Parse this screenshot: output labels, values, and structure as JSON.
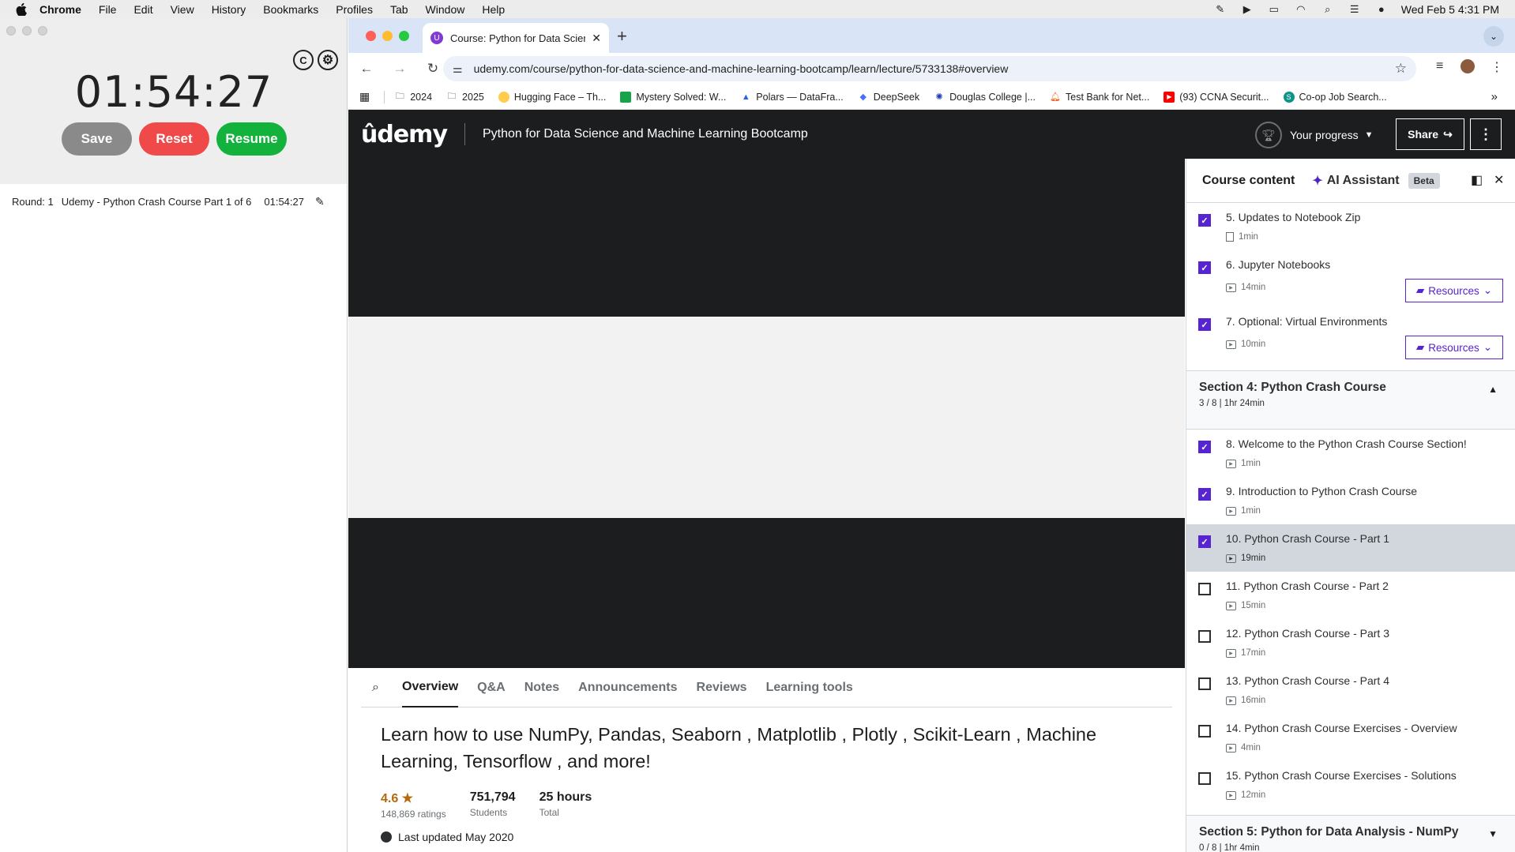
{
  "menubar": {
    "app": "Chrome",
    "items": [
      "File",
      "Edit",
      "View",
      "History",
      "Bookmarks",
      "Profiles",
      "Tab",
      "Window",
      "Help"
    ],
    "datetime": "Wed Feb 5  4:31 PM"
  },
  "timer": {
    "time": "01:54:27",
    "save": "Save",
    "reset": "Reset",
    "resume": "Resume",
    "round_label": "Round: 1",
    "task": "Udemy - Python Crash Course Part 1 of 6",
    "task_time": "01:54:27",
    "counter_glyph": "C",
    "colors": {
      "save": "#8a8a8a",
      "reset": "#f0494a",
      "resume": "#13b23c"
    }
  },
  "browser": {
    "tab_title": "Course: Python for Data Scier",
    "url": "udemy.com/course/python-for-data-science-and-machine-learning-bootcamp/learn/lecture/5733138#overview",
    "bookmarks": [
      "2024",
      "2025",
      "Hugging Face – Th...",
      "Mystery Solved: W...",
      "Polars — DataFra...",
      "DeepSeek",
      "Douglas College |...",
      "Test Bank for Net...",
      "(93) CCNA Securit...",
      "Co-op Job Search..."
    ]
  },
  "udemy": {
    "logo": "ûdemy",
    "course_title": "Python for Data Science and Machine Learning Bootcamp",
    "progress": "Your progress",
    "share": "Share",
    "tabs": [
      "Overview",
      "Q&A",
      "Notes",
      "Announcements",
      "Reviews",
      "Learning tools"
    ],
    "headline": "Learn how to use NumPy, Pandas, Seaborn , Matplotlib , Plotly , Scikit-Learn , Machine Learning, Tensorflow , and more!",
    "stats": [
      {
        "value": "4.6 ★",
        "label": "148,869 ratings"
      },
      {
        "value": "751,794",
        "label": "Students"
      },
      {
        "value": "25 hours",
        "label": "Total"
      }
    ],
    "updated": "Last updated May 2020",
    "accent": "#5624d0"
  },
  "sidebar": {
    "course_content": "Course content",
    "ai_assistant": "AI Assistant",
    "beta": "Beta",
    "resources": "Resources",
    "items_top": [
      {
        "name": "5. Updates to Notebook Zip",
        "duration": "1min",
        "done": true,
        "kind": "file",
        "resources": false
      },
      {
        "name": "6. Jupyter Notebooks",
        "duration": "14min",
        "done": true,
        "kind": "video",
        "resources": true
      },
      {
        "name": "7. Optional: Virtual Environments",
        "duration": "10min",
        "done": true,
        "kind": "video",
        "resources": true
      }
    ],
    "section4": {
      "title": "Section 4: Python Crash Course",
      "sub": "3 / 8 | 1hr 24min"
    },
    "items_s4": [
      {
        "name": "8. Welcome to the Python Crash Course Section!",
        "duration": "1min",
        "done": true
      },
      {
        "name": "9. Introduction to Python Crash Course",
        "duration": "1min",
        "done": true
      },
      {
        "name": "10. Python Crash Course - Part 1",
        "duration": "19min",
        "done": true,
        "current": true
      },
      {
        "name": "11. Python Crash Course - Part 2",
        "duration": "15min",
        "done": false
      },
      {
        "name": "12. Python Crash Course - Part 3",
        "duration": "17min",
        "done": false
      },
      {
        "name": "13. Python Crash Course - Part 4",
        "duration": "16min",
        "done": false
      },
      {
        "name": "14. Python Crash Course Exercises - Overview",
        "duration": "4min",
        "done": false
      },
      {
        "name": "15. Python Crash Course Exercises - Solutions",
        "duration": "12min",
        "done": false
      }
    ],
    "section5": {
      "title": "Section 5: Python for Data Analysis - NumPy",
      "sub": "0 / 8 | 1hr 4min"
    }
  }
}
